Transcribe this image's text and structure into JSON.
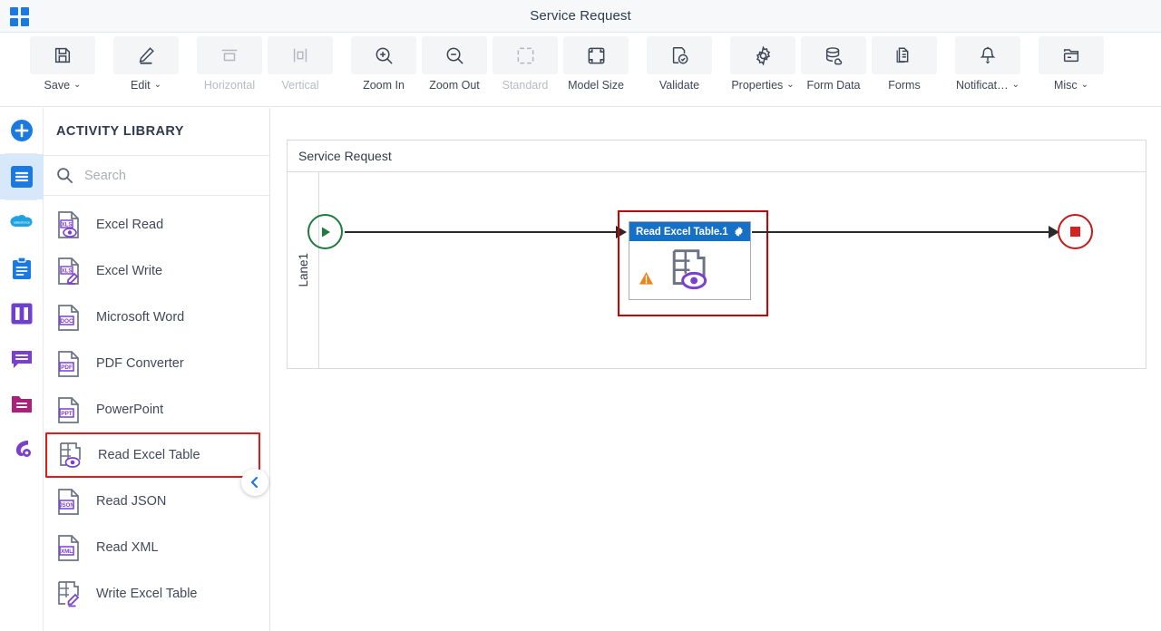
{
  "titlebar": {
    "app_launcher_icon": "grid-apps-icon",
    "title": "Service Request"
  },
  "toolbar": {
    "items": [
      {
        "label": "Save",
        "icon": "floppy-disk-icon",
        "caret": "⌄",
        "disabled": false
      },
      {
        "label": "Edit",
        "icon": "pencil-icon",
        "caret": "⌄",
        "disabled": false
      },
      {
        "label": "Horizontal",
        "icon": "align-horizontal-icon",
        "caret": "",
        "disabled": true
      },
      {
        "label": "Vertical",
        "icon": "align-vertical-icon",
        "caret": "",
        "disabled": true
      },
      {
        "label": "Zoom In",
        "icon": "zoom-in-icon",
        "caret": "",
        "disabled": false
      },
      {
        "label": "Zoom Out",
        "icon": "zoom-out-icon",
        "caret": "",
        "disabled": false
      },
      {
        "label": "Standard",
        "icon": "standard-size-icon",
        "caret": "",
        "disabled": true
      },
      {
        "label": "Model Size",
        "icon": "model-size-icon",
        "caret": "",
        "disabled": false
      },
      {
        "label": "Validate",
        "icon": "validate-check-icon",
        "caret": "",
        "disabled": false
      },
      {
        "label": "Properties",
        "icon": "gear-icon",
        "caret": "⌄",
        "disabled": false
      },
      {
        "label": "Form Data",
        "icon": "database-icon",
        "caret": "",
        "disabled": false
      },
      {
        "label": "Forms",
        "icon": "document-copy-icon",
        "caret": "",
        "disabled": false
      },
      {
        "label": "Notificat…",
        "icon": "bell-icon",
        "caret": "⌄",
        "disabled": false
      },
      {
        "label": "Misc",
        "icon": "folder-card-icon",
        "caret": "⌄",
        "disabled": false
      }
    ]
  },
  "rail": {
    "items": [
      {
        "name": "add-new-icon",
        "color": "#1a7ae0",
        "active": false
      },
      {
        "name": "activity-library-icon",
        "color": "#1a7ae0",
        "active": true
      },
      {
        "name": "salesforce-cloud-icon",
        "color": "#1fa3e0",
        "active": false
      },
      {
        "name": "clipboard-icon",
        "color": "#1a7ae0",
        "active": false
      },
      {
        "name": "columns-icon",
        "color": "#6f3fd1",
        "active": false
      },
      {
        "name": "comment-icon",
        "color": "#7a3fd1",
        "active": false
      },
      {
        "name": "folder-icon",
        "color": "#aa2179",
        "active": false
      },
      {
        "name": "automation-icon",
        "color": "#7a3fd1",
        "active": false
      }
    ]
  },
  "panel": {
    "title": "ACTIVITY LIBRARY",
    "search": {
      "value": "",
      "placeholder": "Search",
      "icon": "search-icon"
    },
    "collapse_icon": "chevron-left-icon",
    "activities": [
      {
        "label": "Excel Read",
        "icon": "xls-read-icon",
        "badge": "XLS",
        "selected": false
      },
      {
        "label": "Excel Write",
        "icon": "xls-write-icon",
        "badge": "XLS",
        "selected": false
      },
      {
        "label": "Microsoft Word",
        "icon": "doc-file-icon",
        "badge": "DOC",
        "selected": false
      },
      {
        "label": "PDF Converter",
        "icon": "pdf-file-icon",
        "badge": "PDF",
        "selected": false
      },
      {
        "label": "PowerPoint",
        "icon": "ppt-file-icon",
        "badge": "PPT",
        "selected": false
      },
      {
        "label": "Read Excel Table",
        "icon": "table-read-icon",
        "badge": "",
        "selected": true
      },
      {
        "label": "Read JSON",
        "icon": "json-file-icon",
        "badge": "JSON",
        "selected": false
      },
      {
        "label": "Read XML",
        "icon": "xml-file-icon",
        "badge": "XML",
        "selected": false
      },
      {
        "label": "Write Excel Table",
        "icon": "table-write-icon",
        "badge": "",
        "selected": false
      }
    ]
  },
  "canvas": {
    "pool_title": "Service Request",
    "lane_label": "Lane1",
    "start_event": {
      "name": "start-event",
      "icon": "play-triangle-icon"
    },
    "end_event": {
      "name": "end-event",
      "icon": "stop-square-icon"
    },
    "task": {
      "title": "Read Excel Table.1",
      "gear_icon": "gear-icon",
      "warning_icon": "warning-triangle-icon",
      "body_icon": "table-read-icon",
      "selected": true
    }
  },
  "colors": {
    "accent_blue": "#1a7ae0",
    "task_header": "#1671c6",
    "selection_red": "#cc0000",
    "start_green": "#1f7a3f",
    "end_red": "#c11b1b",
    "warning_orange": "#e8861a",
    "icon_purple": "#7a3fd1",
    "icon_gray": "#6b7385"
  }
}
